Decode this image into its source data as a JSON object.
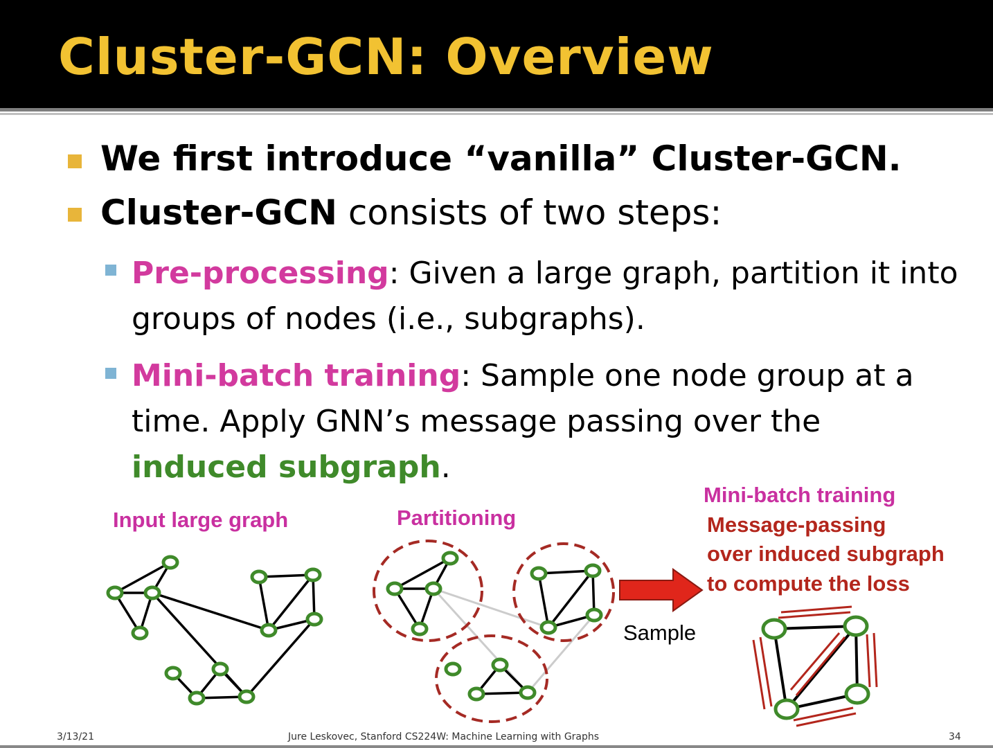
{
  "title": "Cluster-GCN: Overview",
  "bullets": {
    "b1": "We first introduce “vanilla” Cluster-GCN.",
    "b2_bold": "Cluster-GCN",
    "b2_rest": " consists of two steps:"
  },
  "sub1": {
    "term": "Pre-processing",
    "line1_rest": ": Given a large graph, partition it into",
    "line2": "groups of nodes (i.e., subgraphs)."
  },
  "sub2": {
    "term": "Mini-batch training",
    "line1_rest": ": Sample one node group at a",
    "line2": "time. Apply GNN’s message passing over the",
    "line3_term": "induced subgraph",
    "line3_rest": "."
  },
  "figure": {
    "input_label": "Input large graph",
    "partition_label": "Partitioning",
    "minibatch_label": "Mini-batch training",
    "mp_line1": "Message-passing",
    "mp_line2": "over induced subgraph",
    "mp_line3": "to compute the loss",
    "sample_label": "Sample"
  },
  "footer": {
    "date": "3/13/21",
    "credit": "Jure Leskovec, Stanford CS224W: Machine Learning with Graphs",
    "page": "34"
  },
  "colors": {
    "title": "#f2c232",
    "accent_pink": "#d23a9e",
    "accent_green": "#3f8a2a",
    "accent_red": "#b3261c",
    "node": "#3f8a2a"
  }
}
